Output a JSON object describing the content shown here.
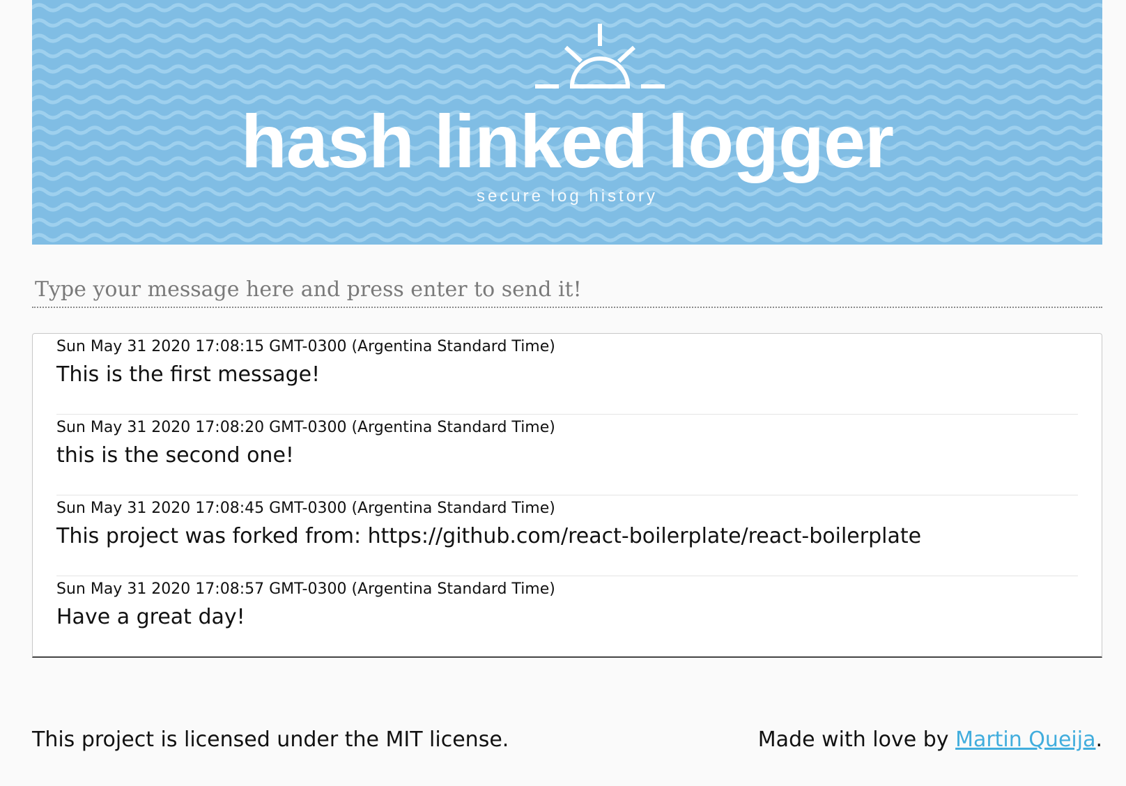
{
  "header": {
    "title": "hash linked logger",
    "subtitle": "secure log history",
    "background_color": "#84c1e6",
    "logo_icon": "sunrise-icon"
  },
  "input": {
    "placeholder": "Type your message here and press enter to send it!",
    "value": ""
  },
  "log": {
    "entries": [
      {
        "timestamp": "Sun May 31 2020 17:08:15 GMT-0300 (Argentina Standard Time)",
        "message": "This is the first message!"
      },
      {
        "timestamp": "Sun May 31 2020 17:08:20 GMT-0300 (Argentina Standard Time)",
        "message": "this is the second one!"
      },
      {
        "timestamp": "Sun May 31 2020 17:08:45 GMT-0300 (Argentina Standard Time)",
        "message": "This project was forked from: https://github.com/react-boilerplate/react-boilerplate"
      },
      {
        "timestamp": "Sun May 31 2020 17:08:57 GMT-0300 (Argentina Standard Time)",
        "message": "Have a great day!"
      }
    ]
  },
  "footer": {
    "license_text": "This project is licensed under the MIT license.",
    "credit_prefix": "Made with love by ",
    "author_name": "Martin Queija",
    "credit_suffix": ".",
    "link_color": "#41addd"
  }
}
